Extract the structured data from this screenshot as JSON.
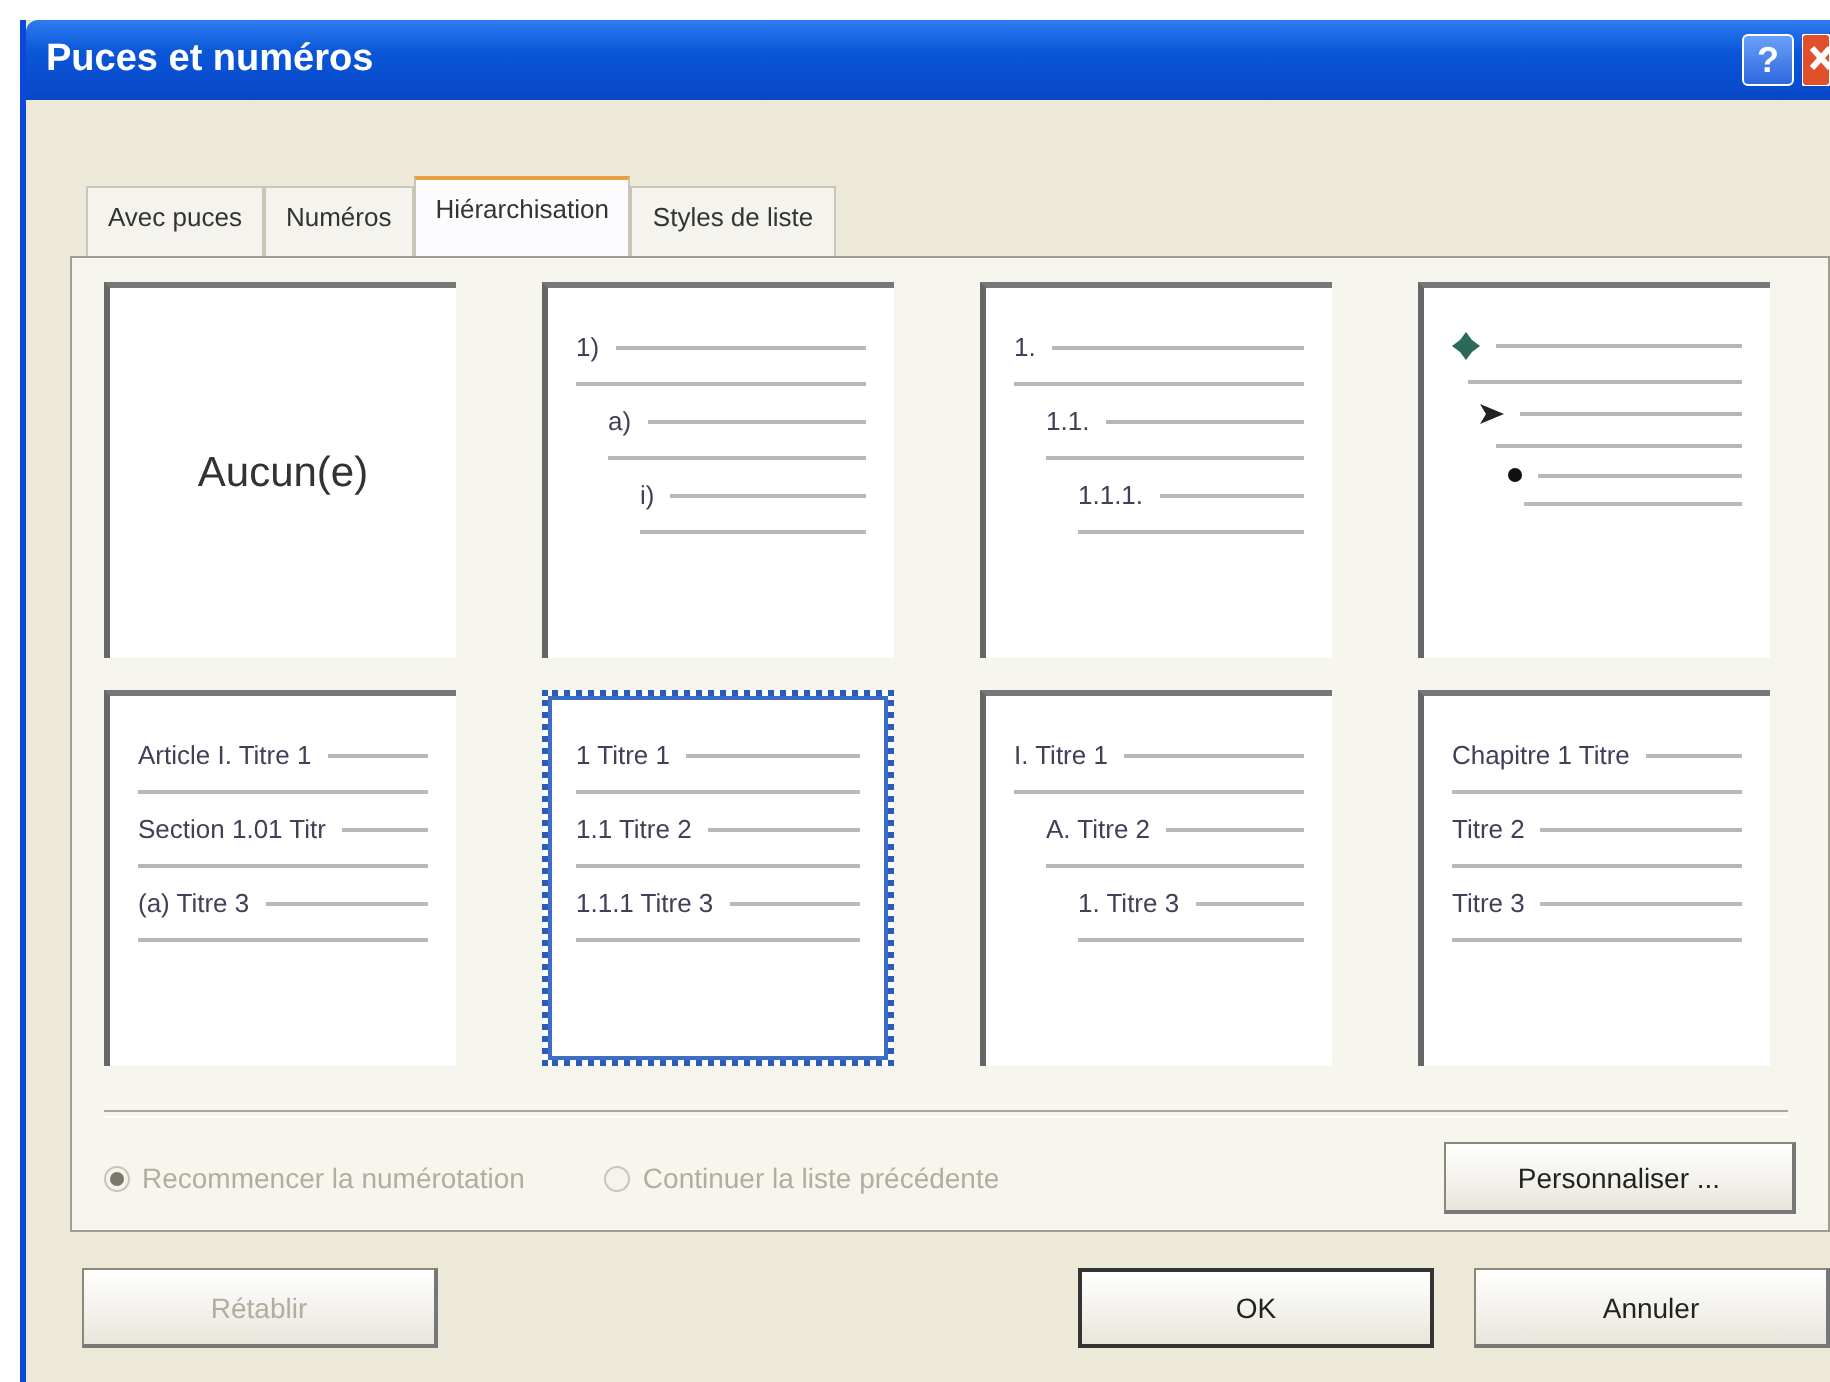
{
  "window": {
    "title": "Puces et numéros",
    "help": "?"
  },
  "tabs": [
    {
      "label": "Avec puces",
      "selected": false
    },
    {
      "label": "Numéros",
      "selected": false
    },
    {
      "label": "Hiérarchisation",
      "selected": true
    },
    {
      "label": "Styles de liste",
      "selected": false
    }
  ],
  "tiles": [
    {
      "kind": "none",
      "label": "Aucun(e)",
      "selected": false
    },
    {
      "kind": "stepped",
      "levels": [
        "1)",
        "a)",
        "i)"
      ],
      "selected": false
    },
    {
      "kind": "stepped",
      "levels": [
        "1.",
        "1.1.",
        "1.1.1."
      ],
      "selected": false
    },
    {
      "kind": "bullets",
      "selected": false
    },
    {
      "kind": "flat",
      "levels": [
        "Article I. Titre 1",
        "Section 1.01 Titr",
        "(a) Titre 3"
      ],
      "selected": false
    },
    {
      "kind": "flat",
      "levels": [
        "1 Titre 1",
        "1.1 Titre 2",
        "1.1.1 Titre 3"
      ],
      "selected": true
    },
    {
      "kind": "stepped",
      "levels": [
        "I. Titre 1",
        "A. Titre 2",
        "1. Titre 3"
      ],
      "selected": false
    },
    {
      "kind": "flat",
      "levels": [
        "Chapitre 1 Titre",
        "Titre 2",
        "Titre 3"
      ],
      "selected": false
    }
  ],
  "options": [
    {
      "label": "Recommencer la numérotation",
      "selected": true,
      "disabled": true
    },
    {
      "label": "Continuer la liste précédente",
      "selected": false,
      "disabled": true
    }
  ],
  "customize_button": {
    "label": "Personnaliser ...",
    "disabled": false
  },
  "buttons": [
    {
      "label": "Rétablir",
      "disabled": true,
      "default": false
    },
    {
      "label": "OK",
      "disabled": false,
      "default": true
    },
    {
      "label": "Annuler",
      "disabled": false,
      "default": false
    }
  ]
}
